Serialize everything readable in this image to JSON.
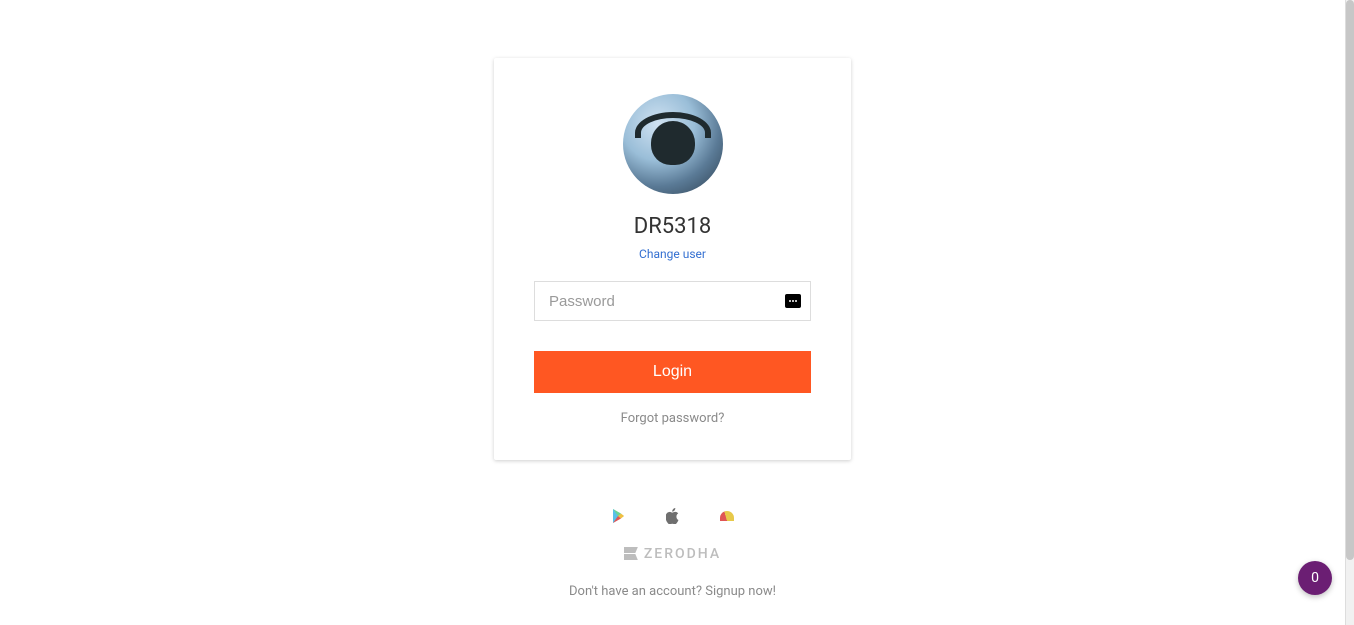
{
  "user": {
    "id": "DR5318",
    "change_user_label": "Change user"
  },
  "form": {
    "password_placeholder": "Password",
    "login_button_label": "Login",
    "forgot_password_label": "Forgot password?"
  },
  "footer": {
    "brand_name": "ZERODHA",
    "signup_prompt": "Don't have an account? ",
    "signup_link_label": "Signup now!"
  },
  "fab": {
    "badge": "0"
  }
}
